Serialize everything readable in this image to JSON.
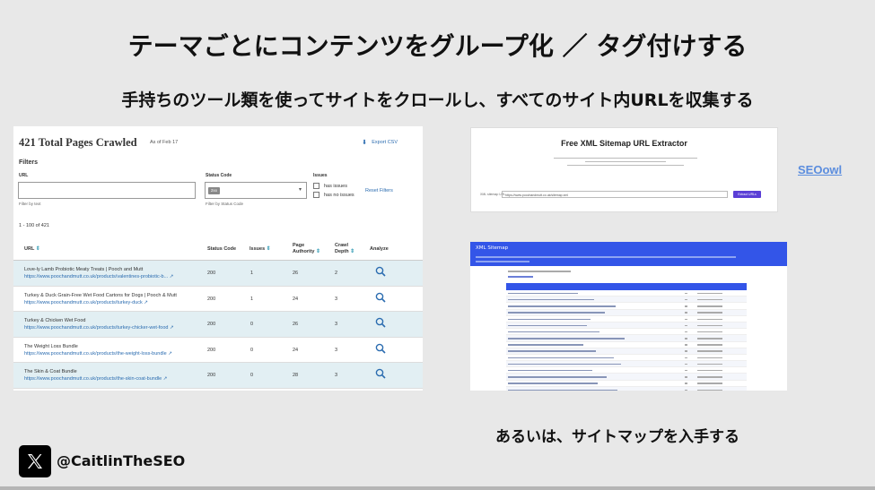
{
  "slide": {
    "title": "テーマごとにコンテンツをグループ化 ／ タグ付けする",
    "subtitle": "手持ちのツール類を使ってサイトをクロールし、すべてのサイト内URLを収集する",
    "caption": "あるいは、サイトマップを入手する",
    "handle": "@CaitlinTheSEO",
    "seoowl_link": "SEOowl"
  },
  "crawl": {
    "title": "421 Total Pages Crawled",
    "as_of": "As of Feb 17",
    "export": "Export CSV",
    "filters": "Filters",
    "url_label": "URL",
    "url_placeholder": "",
    "url_help": "Filter by text",
    "status_label": "Status Code",
    "status_chip": "2xx",
    "status_help": "Filter by Status Code",
    "issues_label": "Issues",
    "has_issues": "has issues",
    "has_no_issues": "has no issues",
    "reset": "Reset Filters",
    "range": "1 - 100 of 421",
    "columns": {
      "url": "URL",
      "status": "Status Code",
      "issues": "Issues",
      "pa1": "Page",
      "pa2": "Authority",
      "cd1": "Crawl",
      "cd2": "Depth",
      "analyze": "Analyze"
    },
    "rows": [
      {
        "title": "Love-ly Lamb Probiotic Meaty Treats | Pooch and Mutt",
        "url": "https://www.poochandmutt.co.uk/products/valentines-probiotic-b...",
        "status": "200",
        "issues": "1",
        "pa": "26",
        "depth": "2"
      },
      {
        "title": "Turkey & Duck Grain-Free Wet Food Cartons for Dogs | Pooch & Mutt",
        "url": "https://www.poochandmutt.co.uk/products/turkey-duck",
        "status": "200",
        "issues": "1",
        "pa": "24",
        "depth": "3"
      },
      {
        "title": "Turkey & Chicken Wet Food",
        "url": "https://www.poochandmutt.co.uk/products/turkey-chicker-wet-food",
        "status": "200",
        "issues": "0",
        "pa": "26",
        "depth": "3"
      },
      {
        "title": "The Weight Loss Bundle",
        "url": "https://www.poochandmutt.co.uk/products/the-weight-loss-bundle",
        "status": "200",
        "issues": "0",
        "pa": "24",
        "depth": "3"
      },
      {
        "title": "The Skin & Coat Bundle",
        "url": "https://www.poochandmutt.co.uk/products/the-skin-coat-bundle",
        "status": "200",
        "issues": "0",
        "pa": "28",
        "depth": "3"
      }
    ]
  },
  "extractor": {
    "title": "Free XML Sitemap URL Extractor",
    "desc": "Extract URLs from any XML sitemap",
    "input_label": "XML sitemap URL",
    "input_value": "https://www.poochandmutt.co.uk/sitemap.xml",
    "button": "Extract URLs"
  },
  "sitemap": {
    "header_title": "XML Sitemap",
    "row_count": 18
  },
  "colors": {
    "accent_blue": "#3355e8",
    "link_blue": "#2b6cb0",
    "row_teal": "#e2eff3",
    "button_purple": "#5b3fd6"
  }
}
